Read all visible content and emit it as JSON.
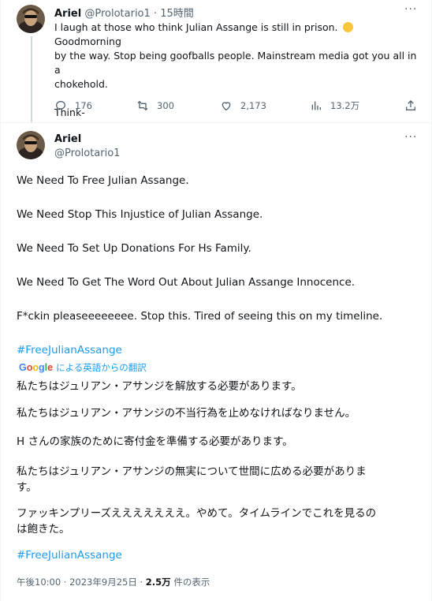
{
  "reply_tweet": {
    "author_name": "Ariel",
    "author_handle": "@Prolotario1",
    "separator": "·",
    "time_ago": "15時間",
    "line1_pre": "I laugh at those who think Julian Assange is still in prison.",
    "line1_post": "Goodmorning",
    "line2": "by the way. Stop being goofballs people. Mainstream media got you all in a",
    "line3": "chokehold.",
    "line4": "Think-",
    "emoji_icon": "shushing-face-icon",
    "replies": "176",
    "retweets": "300",
    "likes": "2,173",
    "views": "13.2万"
  },
  "main_tweet": {
    "author_name": "Ariel",
    "author_handle": "@Prolotario1",
    "paragraphs": [
      "We Need To Free Julian Assange.",
      "We Need Stop This Injustice of Julian Assange.",
      "We Need To Set Up Donations For Hs Family.",
      "We Need To Get The Word Out About Julian Assange Innocence.",
      "F*ckin pleaseeeeeeee. Stop this.  Tired of seeing this on my timeline."
    ],
    "hashtag": "#FreeJulianAssange",
    "translation": {
      "brand": "Google",
      "label": "による英語からの翻訳",
      "paragraphs": [
        "私たちはジュリアン・アサンジを解放する必要があります。",
        "私たちはジュリアン・アサンジの不当行為を止めなければなりません。",
        "H さんの家族のために寄付金を準備する必要があります。",
        "私たちはジュリアン・アサンジの無実について世間に広める必要がありま",
        "す。",
        "ファッキンプリーズえええええええ。やめて。タイムラインでこれを見るの",
        "は飽きた。"
      ],
      "hashtag": "#FreeJulianAssange"
    },
    "timestamp": "午後10:00 · 2023年9月25日 ·",
    "view_count": "2.5万",
    "view_suffix": "件の表示"
  },
  "more_icon": "more-icon",
  "colors": {
    "link": "#1d9bf0",
    "muted": "#536471",
    "text": "#0f1419",
    "line": "#cfd9de"
  }
}
